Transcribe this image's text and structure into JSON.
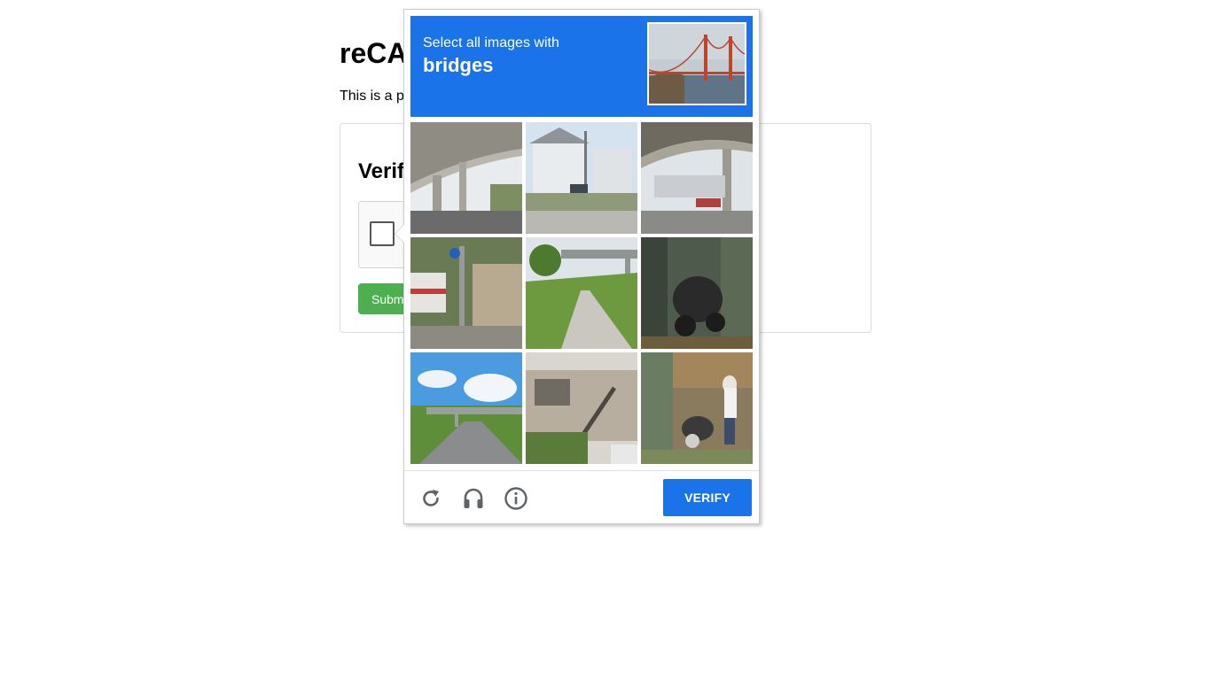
{
  "page": {
    "title": "reCAPTCHA",
    "description": "This is a page with a reCAPTCHA challenge.",
    "card_heading": "Verify",
    "submit_label": "Submit"
  },
  "challenge": {
    "prompt": "Select all images with",
    "target": "bridges",
    "sample_image": "golden-gate-bridge",
    "tiles": [
      {
        "scene": "highway overpass underside"
      },
      {
        "scene": "white house on street corner"
      },
      {
        "scene": "elevated road over parking lot"
      },
      {
        "scene": "street with bus and signs"
      },
      {
        "scene": "grassy path under overpass"
      },
      {
        "scene": "parked motorcycle"
      },
      {
        "scene": "highway under bridge with sky"
      },
      {
        "scene": "old house with stairs"
      },
      {
        "scene": "scooter and pedestrian"
      }
    ],
    "footer_icons": [
      "reload-icon",
      "headphones-icon",
      "info-icon"
    ],
    "verify_label": "VERIFY"
  },
  "colors": {
    "accent": "#1a73e8",
    "submit": "#4caf50"
  }
}
